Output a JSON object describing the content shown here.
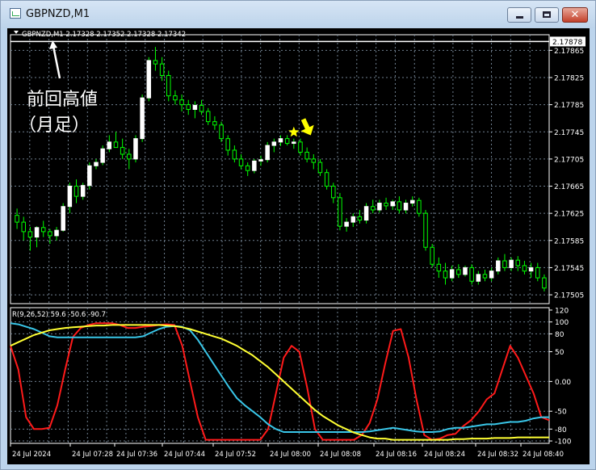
{
  "window": {
    "title": "GBPNZD,M1",
    "buttons": {
      "minimize": "minimize",
      "maximize": "maximize",
      "close": "✕"
    }
  },
  "chart_data": [
    {
      "type": "candlestick",
      "symbol_info": "GBPNZD,M1  2.17328 2.17352 2.17328 2.17342",
      "current_price_label": "2.17878",
      "y_ticks": [
        "2.17865",
        "2.17825",
        "2.17785",
        "2.17745",
        "2.17705",
        "2.17665",
        "2.17625",
        "2.17585",
        "2.17545",
        "2.17505"
      ],
      "ylim": [
        2.17492,
        2.17888
      ],
      "high_line": 2.17878,
      "grid": true,
      "colors": {
        "bull": "#ffffff",
        "bear": "#00ff00",
        "wick": "#00ff00",
        "grid": "#708090",
        "annotation": "#ffffff",
        "marker": "#ffff00"
      },
      "annotation_line1": "前回高値",
      "annotation_line2": "（月足）",
      "star_marker_index": 42,
      "arrow_marker_index": 44,
      "candles": [
        [
          2.17622,
          2.17632,
          2.17602,
          2.17612
        ],
        [
          2.17612,
          2.1762,
          2.17585,
          2.17598
        ],
        [
          2.17598,
          2.17605,
          2.1757,
          2.1759
        ],
        [
          2.1759,
          2.17606,
          2.17575,
          2.17604
        ],
        [
          2.17604,
          2.17614,
          2.1759,
          2.17598
        ],
        [
          2.17598,
          2.17602,
          2.1758,
          2.17592
        ],
        [
          2.17592,
          2.17605,
          2.17585,
          2.176
        ],
        [
          2.176,
          2.1764,
          2.17598,
          2.17635
        ],
        [
          2.17635,
          2.1767,
          2.17625,
          2.17665
        ],
        [
          2.17665,
          2.17675,
          2.1764,
          2.1765
        ],
        [
          2.1765,
          2.1767,
          2.17645,
          2.17666
        ],
        [
          2.17666,
          2.177,
          2.1766,
          2.17695
        ],
        [
          2.17695,
          2.17705,
          2.1769,
          2.177
        ],
        [
          2.177,
          2.17725,
          2.17696,
          2.1772
        ],
        [
          2.1772,
          2.1774,
          2.17715,
          2.1773
        ],
        [
          2.1773,
          2.17745,
          2.17725,
          2.17722
        ],
        [
          2.17722,
          2.17735,
          2.17705,
          2.17712
        ],
        [
          2.17712,
          2.1772,
          2.1769,
          2.17705
        ],
        [
          2.17705,
          2.1774,
          2.177,
          2.17735
        ],
        [
          2.17735,
          2.178,
          2.1773,
          2.17795
        ],
        [
          2.17795,
          2.17855,
          2.1779,
          2.1785
        ],
        [
          2.1785,
          2.1787,
          2.17835,
          2.17845
        ],
        [
          2.17845,
          2.17855,
          2.1782,
          2.17828
        ],
        [
          2.17828,
          2.17835,
          2.1779,
          2.17798
        ],
        [
          2.17798,
          2.17806,
          2.17785,
          2.17792
        ],
        [
          2.17792,
          2.178,
          2.17775,
          2.17785
        ],
        [
          2.17785,
          2.17792,
          2.1777,
          2.17778
        ],
        [
          2.17778,
          2.1779,
          2.17765,
          2.17784
        ],
        [
          2.17784,
          2.17792,
          2.1777,
          2.17775
        ],
        [
          2.17775,
          2.1778,
          2.17755,
          2.1776
        ],
        [
          2.1776,
          2.17768,
          2.17748,
          2.17755
        ],
        [
          2.17755,
          2.1776,
          2.1773,
          2.17735
        ],
        [
          2.17735,
          2.1774,
          2.1771,
          2.17718
        ],
        [
          2.17718,
          2.17725,
          2.177,
          2.17705
        ],
        [
          2.17705,
          2.17712,
          2.1769,
          2.17695
        ],
        [
          2.17695,
          2.177,
          2.1768,
          2.17688
        ],
        [
          2.17688,
          2.17705,
          2.17684,
          2.17702
        ],
        [
          2.17702,
          2.1771,
          2.17695,
          2.17704
        ],
        [
          2.17704,
          2.1773,
          2.177,
          2.17725
        ],
        [
          2.17725,
          2.17735,
          2.17715,
          2.1773
        ],
        [
          2.1773,
          2.1774,
          2.17724,
          2.17735
        ],
        [
          2.17735,
          2.1774,
          2.17725,
          2.17728
        ],
        [
          2.17728,
          2.17735,
          2.1772,
          2.1773
        ],
        [
          2.1773,
          2.17735,
          2.1771,
          2.17715
        ],
        [
          2.17715,
          2.17722,
          2.177,
          2.17705
        ],
        [
          2.17705,
          2.17712,
          2.1769,
          2.177
        ],
        [
          2.177,
          2.17705,
          2.1768,
          2.17685
        ],
        [
          2.17685,
          2.1769,
          2.1766,
          2.17665
        ],
        [
          2.17665,
          2.1767,
          2.1764,
          2.17648
        ],
        [
          2.17648,
          2.17655,
          2.176,
          2.17606
        ],
        [
          2.17606,
          2.17618,
          2.17598,
          2.17612
        ],
        [
          2.17612,
          2.17625,
          2.17605,
          2.1762
        ],
        [
          2.1762,
          2.1763,
          2.1761,
          2.17615
        ],
        [
          2.17615,
          2.1764,
          2.1761,
          2.17635
        ],
        [
          2.17635,
          2.17645,
          2.17625,
          2.1763
        ],
        [
          2.1763,
          2.17645,
          2.17626,
          2.1764
        ],
        [
          2.1764,
          2.17648,
          2.1763,
          2.17636
        ],
        [
          2.17636,
          2.17645,
          2.1763,
          2.17642
        ],
        [
          2.17642,
          2.1765,
          2.17625,
          2.1763
        ],
        [
          2.1763,
          2.17645,
          2.17625,
          2.1764
        ],
        [
          2.1764,
          2.1765,
          2.17635,
          2.17644
        ],
        [
          2.17644,
          2.17648,
          2.1762,
          2.17625
        ],
        [
          2.17625,
          2.1763,
          2.1757,
          2.17575
        ],
        [
          2.17575,
          2.1758,
          2.17545,
          2.1755
        ],
        [
          2.1755,
          2.1756,
          2.1753,
          2.1754
        ],
        [
          2.1754,
          2.17552,
          2.1752,
          2.1753
        ],
        [
          2.1753,
          2.17548,
          2.17525,
          2.17542
        ],
        [
          2.17542,
          2.1755,
          2.1753,
          2.17535
        ],
        [
          2.17535,
          2.17548,
          2.17532,
          2.17545
        ],
        [
          2.17545,
          2.1755,
          2.1752,
          2.17525
        ],
        [
          2.17525,
          2.1754,
          2.1752,
          2.17535
        ],
        [
          2.17535,
          2.17542,
          2.17525,
          2.1753
        ],
        [
          2.1753,
          2.17545,
          2.17525,
          2.1754
        ],
        [
          2.1754,
          2.1756,
          2.17535,
          2.17555
        ],
        [
          2.17555,
          2.17565,
          2.1754,
          2.17545
        ],
        [
          2.17545,
          2.1756,
          2.1754,
          2.17556
        ],
        [
          2.17556,
          2.17562,
          2.1754,
          2.17548
        ],
        [
          2.17548,
          2.17555,
          2.17535,
          2.1754
        ],
        [
          2.1754,
          2.17552,
          2.1753,
          2.17545
        ],
        [
          2.17545,
          2.17552,
          2.17525,
          2.1753
        ],
        [
          2.1753,
          2.17535,
          2.1751,
          2.17515
        ]
      ]
    },
    {
      "type": "line",
      "label": "R(9,26,52) 59.6 -50.6 -90.7",
      "ylim": [
        -104,
        124
      ],
      "y_ticks": [
        "120",
        "100",
        "80",
        "50",
        "0.00",
        "-50",
        "-80",
        "-100"
      ],
      "tick_values": [
        120,
        100,
        80,
        50,
        0,
        -50,
        -80,
        -100
      ],
      "x_tick_labels": [
        "24 Jul 2024",
        "24 Jul 07:28",
        "24 Jul 07:36",
        "24 Jul 07:44",
        "24 Jul 07:52",
        "24 Jul 08:00",
        "24 Jul 08:08",
        "24 Jul 08:16",
        "24 Jul 08:24",
        "24 Jul 08:32",
        "24 Jul 08:40"
      ],
      "colors": {
        "red": "#ff1a1a",
        "cyan": "#39c6e8",
        "yellow": "#ffff33"
      },
      "series": [
        {
          "name": "",
          "color": "red",
          "values": [
            60,
            20,
            -60,
            -80,
            -80,
            -78,
            -40,
            20,
            75,
            90,
            95,
            98,
            98,
            98,
            95,
            90,
            90,
            92,
            93,
            95,
            96,
            95,
            60,
            0,
            -60,
            -98,
            -98,
            -98,
            -98,
            -98,
            -98,
            -98,
            -98,
            -80,
            -20,
            40,
            60,
            50,
            -10,
            -80,
            -98,
            -98,
            -98,
            -98,
            -98,
            -90,
            -70,
            -30,
            30,
            85,
            88,
            40,
            -30,
            -90,
            -98,
            -96,
            -90,
            -88,
            -75,
            -65,
            -50,
            -30,
            -20,
            20,
            60,
            40,
            10,
            -20,
            -60,
            -65
          ]
        },
        {
          "name": "",
          "color": "cyan",
          "values": [
            98,
            96,
            92,
            88,
            82,
            76,
            74,
            74,
            74,
            74,
            74,
            74,
            74,
            74,
            74,
            74,
            74,
            76,
            82,
            88,
            92,
            93,
            92,
            86,
            70,
            50,
            30,
            10,
            -10,
            -28,
            -40,
            -50,
            -60,
            -72,
            -80,
            -85,
            -85,
            -85,
            -85,
            -85,
            -85,
            -85,
            -85,
            -85,
            -85,
            -85,
            -84,
            -82,
            -80,
            -78,
            -80,
            -82,
            -84,
            -85,
            -85,
            -84,
            -80,
            -78,
            -78,
            -76,
            -74,
            -72,
            -72,
            -70,
            -68,
            -68,
            -66,
            -62,
            -60,
            -60
          ]
        },
        {
          "name": "",
          "color": "yellow",
          "values": [
            60,
            66,
            72,
            78,
            82,
            86,
            88,
            90,
            91,
            92,
            93,
            94,
            94,
            95,
            95,
            95,
            95,
            95,
            95,
            95,
            94,
            93,
            91,
            88,
            84,
            80,
            76,
            72,
            66,
            60,
            52,
            44,
            34,
            24,
            12,
            0,
            -12,
            -24,
            -36,
            -48,
            -58,
            -66,
            -74,
            -80,
            -86,
            -90,
            -94,
            -96,
            -96,
            -98,
            -98,
            -98,
            -98,
            -98,
            -98,
            -98,
            -98,
            -97,
            -97,
            -96,
            -96,
            -96,
            -95,
            -95,
            -95,
            -94,
            -94,
            -94,
            -94,
            -94
          ]
        }
      ]
    }
  ]
}
